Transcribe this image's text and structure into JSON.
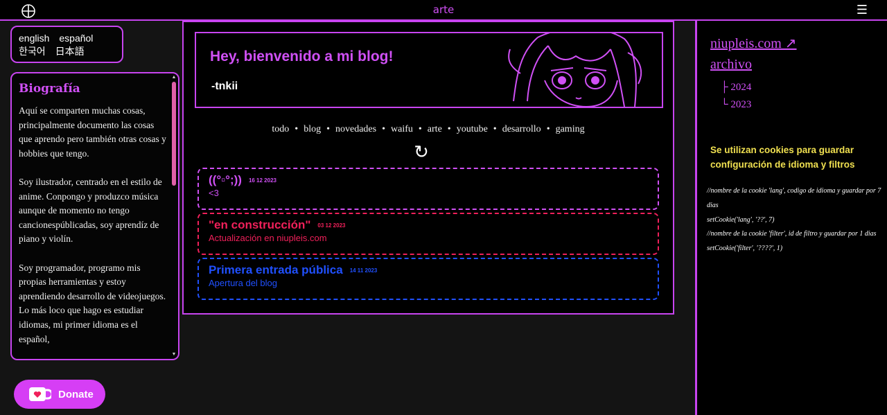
{
  "topbar": {
    "title": "arte",
    "globe_icon": "globe-icon",
    "menu_icon": "hamburger-menu-icon"
  },
  "languages": {
    "row1": [
      "english",
      "español"
    ],
    "row2": [
      "한국어",
      "日本語"
    ]
  },
  "bio": {
    "title": "Biografía",
    "paragraphs": [
      "Aquí se comparten muchas cosas, principalmente documento las cosas que aprendo pero también otras cosas y hobbies que tengo.",
      "Soy ilustrador, centrado en el estilo de anime. Conpongo y produzco música aunque de momento no tengo cancionespúblicadas, soy aprendíz de piano y violín.",
      "Soy programador, programo mis propias herramientas y estoy aprendiendo desarrollo de videojuegos. Lo más loco que hago es estudiar idiomas, mi primer idioma es el español,"
    ]
  },
  "donate": {
    "label": "Donate",
    "icon": "kofi-cup-icon"
  },
  "header": {
    "title": "Hey, bienvenido a mi blog!",
    "author": "-tnkii"
  },
  "filters": [
    "todo",
    "blog",
    "novedades",
    "waifu",
    "arte",
    "youtube",
    "desarrollo",
    "gaming"
  ],
  "refresh_icon": "↻",
  "posts": [
    {
      "title": "((°▫°;))",
      "date": "16 12 2023",
      "subtitle": "<3",
      "color": "#d050f5"
    },
    {
      "title": "\"en construcción\"",
      "date": "03 12 2023",
      "subtitle": "Actualización en niupleis.com",
      "color": "#f0205a"
    },
    {
      "title": "Primera entrada pública",
      "date": "14 11 2023",
      "subtitle": "Apertura del blog",
      "color": "#2050ff"
    }
  ],
  "side_links": {
    "site": "niupleis.com ↗",
    "archive": "archivo"
  },
  "archive_years": [
    "2024",
    "2023"
  ],
  "cookie_note": "Se utilizan cookies para guardar configuración de idioma y filtros",
  "code_lines": [
    "//nombre de la cookie 'lang', codigo de idioma y guardar por 7 dias",
    "setCookie('lang', '??', 7)",
    "//nombre de la cookie 'filter', id de filtro y guardar por 1 dias",
    "setCookie('filter', '????', 1)"
  ],
  "colors": {
    "accent": "#c844f0",
    "pink": "#d050f5",
    "red": "#f0205a",
    "blue": "#2050ff",
    "yellow": "#f0e050",
    "donate": "#d63ef5"
  }
}
